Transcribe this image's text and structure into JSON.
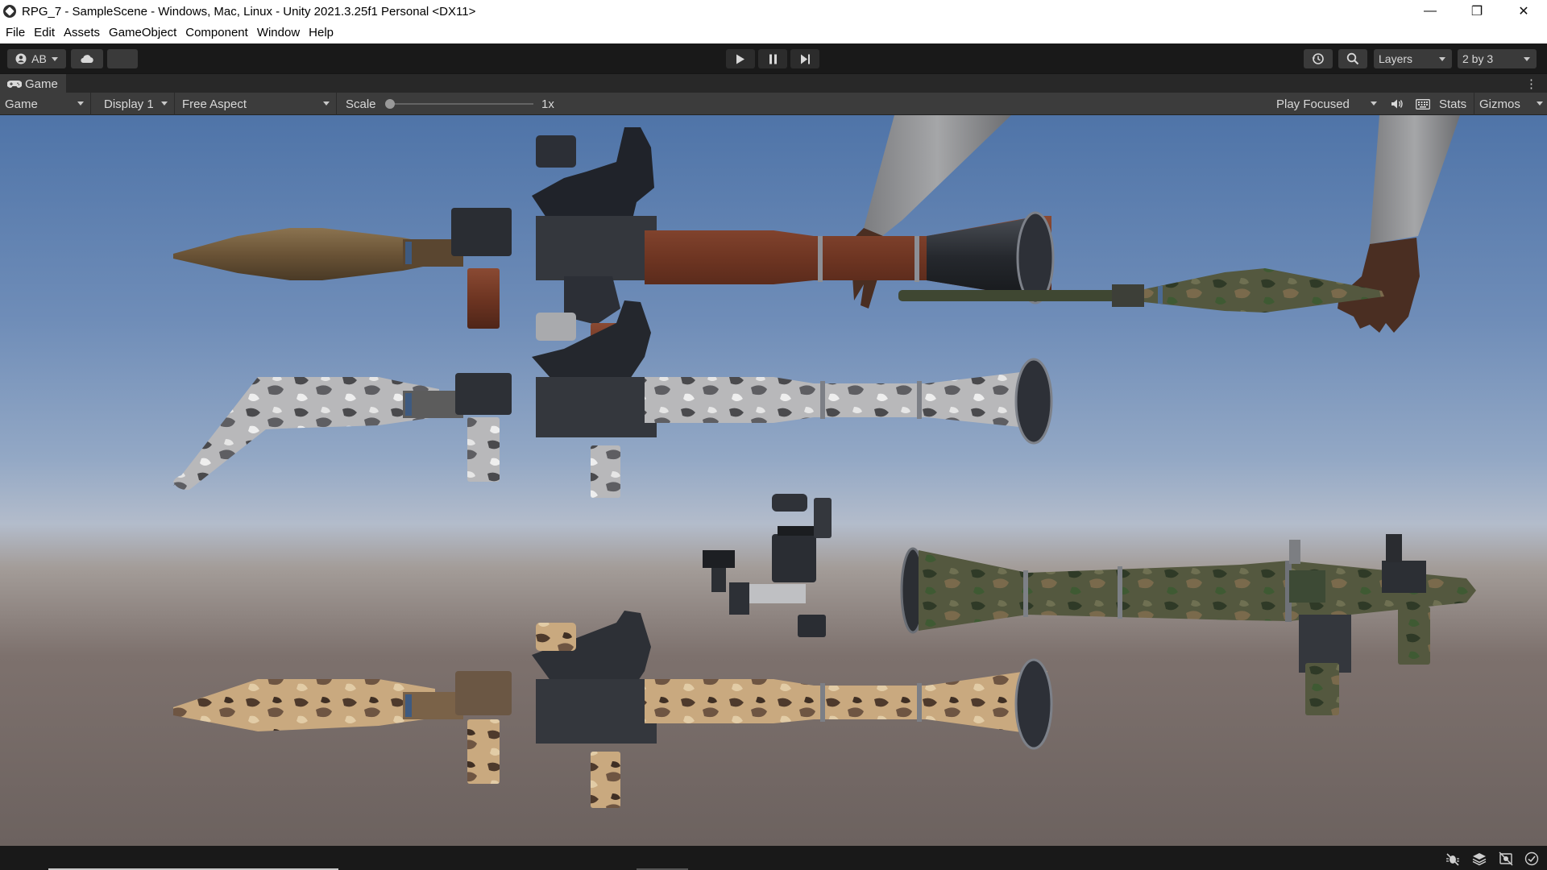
{
  "window": {
    "title": "RPG_7 - SampleScene - Windows, Mac, Linux - Unity 2021.3.25f1 Personal <DX11>",
    "minimize_glyph": "—",
    "restore_glyph": "❐",
    "close_glyph": "✕"
  },
  "menu": {
    "items": [
      "File",
      "Edit",
      "Assets",
      "GameObject",
      "Component",
      "Window",
      "Help"
    ]
  },
  "toolbar": {
    "account_label": "AB",
    "cloud_icon": "cloud-icon",
    "play_icon": "play-icon",
    "pause_icon": "pause-icon",
    "step_icon": "step-icon",
    "layers_label": "Layers",
    "layout_label": "2 by 3"
  },
  "tab": {
    "label": "Game",
    "kebab": "⋮"
  },
  "game_toolbar": {
    "view_select": "Game",
    "display_select": "Display 1",
    "aspect_select": "Free Aspect",
    "scale_label": "Scale",
    "scale_value": "1x",
    "scale_level": 0,
    "play_mode_select": "Play Focused",
    "stats_label": "Stats",
    "gizmos_label": "Gizmos"
  },
  "colors": {
    "editor_bg": "#191919",
    "panel_bg": "#3c3c3c",
    "sky_top": "#4f74a8",
    "ground": "#6c625f"
  }
}
